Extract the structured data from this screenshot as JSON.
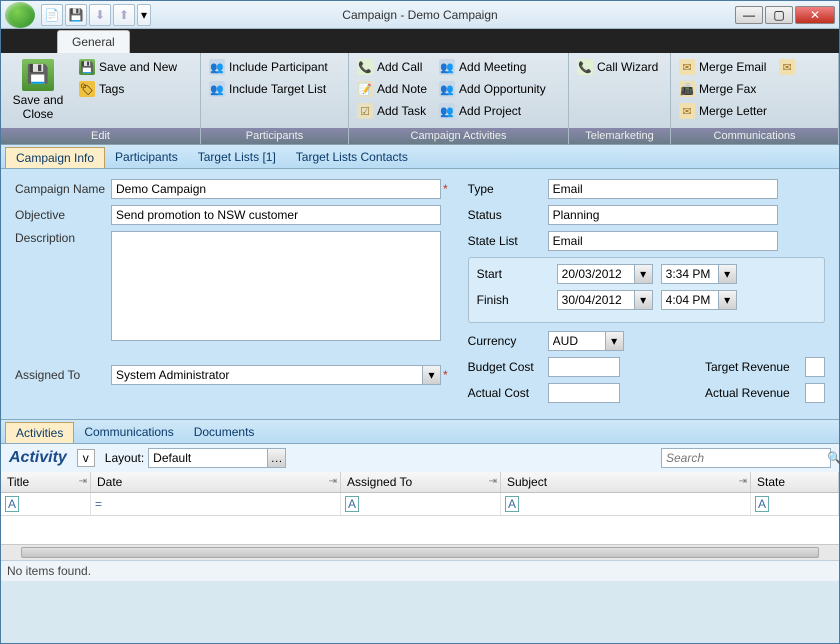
{
  "window": {
    "title": "Campaign - Demo Campaign"
  },
  "ribbon": {
    "tab": "General",
    "groups": {
      "edit": {
        "title": "Edit",
        "save_close": "Save and Close",
        "save_new": "Save and New",
        "tags": "Tags"
      },
      "participants": {
        "title": "Participants",
        "inc_part": "Include Participant",
        "inc_list": "Include Target List"
      },
      "activities": {
        "title": "Campaign Activities",
        "add_call": "Add Call",
        "add_note": "Add Note",
        "add_task": "Add Task",
        "add_meeting": "Add Meeting",
        "add_opp": "Add Opportunity",
        "add_proj": "Add Project"
      },
      "tele": {
        "title": "Telemarketing",
        "wizard": "Call Wizard"
      },
      "comm": {
        "title": "Communications",
        "merge_email": "Merge Email",
        "merge_fax": "Merge Fax",
        "merge_letter": "Merge Letter"
      }
    }
  },
  "tabs": {
    "info": "Campaign Info",
    "participants": "Participants",
    "target_lists": "Target Lists [1]",
    "contacts": "Target Lists Contacts"
  },
  "form": {
    "labels": {
      "name": "Campaign Name",
      "objective": "Objective",
      "description": "Description",
      "assigned": "Assigned To",
      "type": "Type",
      "status": "Status",
      "state_list": "State List",
      "start": "Start",
      "finish": "Finish",
      "currency": "Currency",
      "budget_cost": "Budget Cost",
      "actual_cost": "Actual Cost",
      "target_rev": "Target Revenue",
      "actual_rev": "Actual Revenue"
    },
    "values": {
      "name": "Demo Campaign",
      "objective": "Send promotion to NSW customer",
      "description": "",
      "assigned": "System Administrator",
      "type": "Email",
      "status": "Planning",
      "state_list": "Email",
      "start_date": "20/03/2012",
      "start_time": "3:34 PM",
      "finish_date": "30/04/2012",
      "finish_time": "4:04 PM",
      "currency": "AUD",
      "budget_cost": "",
      "actual_cost": "",
      "target_rev": "",
      "actual_rev": ""
    }
  },
  "sub_tabs": {
    "activities": "Activities",
    "comms": "Communications",
    "docs": "Documents"
  },
  "activity": {
    "title": "Activity",
    "layout_label": "Layout:",
    "layout_value": "Default",
    "search_placeholder": "Search"
  },
  "grid": {
    "cols": {
      "title": "Title",
      "date": "Date",
      "assigned": "Assigned To",
      "subject": "Subject",
      "state": "State"
    },
    "filter_glyph": "A",
    "eq": "="
  },
  "status": "No items found."
}
